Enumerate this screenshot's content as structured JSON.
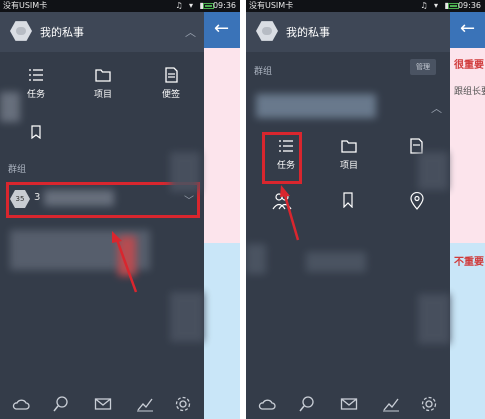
{
  "status_bar": {
    "carrier": "没有USIM卡",
    "time": "09:36"
  },
  "left_screen": {
    "mine_title": "我的私事",
    "quick_actions": [
      {
        "label": "任务",
        "icon": "task-list-icon"
      },
      {
        "label": "项目",
        "icon": "folder-icon"
      },
      {
        "label": "便签",
        "icon": "note-icon"
      }
    ],
    "section_group": "群组",
    "group_avatar_text": "35",
    "group_name": "3"
  },
  "right_screen": {
    "section_group": "群组",
    "manage_label": "管理",
    "group_actions": [
      {
        "label": "任务",
        "icon": "task-list-icon"
      },
      {
        "label": "项目",
        "icon": "folder-icon"
      },
      {
        "label": "",
        "icon": "note-icon"
      },
      {
        "label": "",
        "icon": "members-icon"
      },
      {
        "label": "",
        "icon": "bookmark-icon"
      },
      {
        "label": "",
        "icon": "location-pin-icon"
      }
    ]
  },
  "content_peek": {
    "important_label": "很重要",
    "follow_label": "跟组长要",
    "not_important_label": "不重要"
  },
  "bottom_nav": [
    "cloud-icon",
    "search-icon",
    "mail-icon",
    "chart-icon",
    "gear-icon"
  ],
  "colors": {
    "drawer_bg": "#343c49",
    "header_blue": "#3a73b8",
    "highlight_red": "#d9262e",
    "pink_panel": "#fce4ec",
    "blue_panel": "#c9e6f8"
  }
}
